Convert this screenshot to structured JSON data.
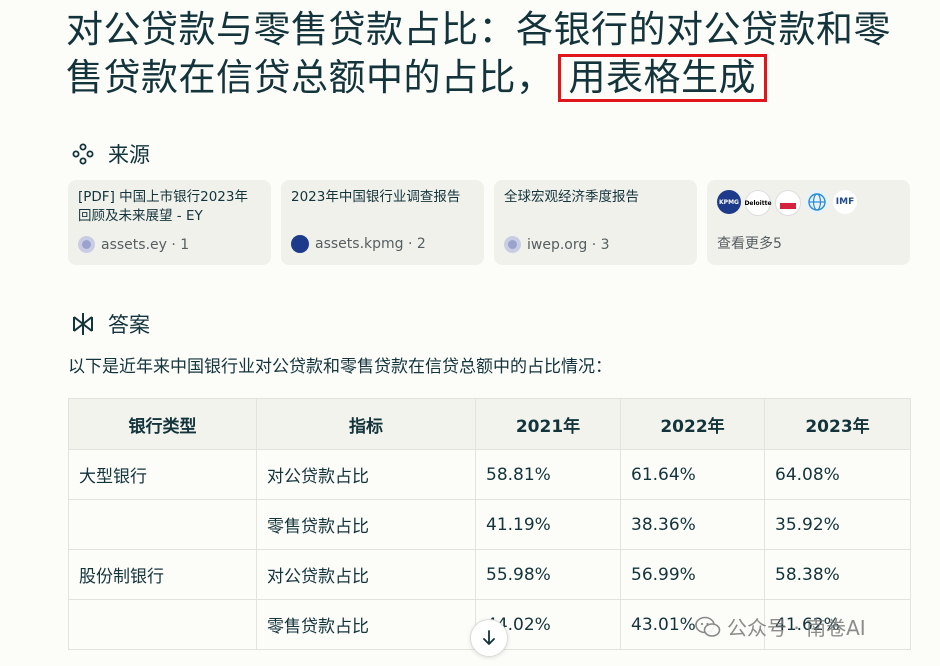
{
  "query": {
    "text": "对公贷款与零售贷款占比：各银行的对公贷款和零售贷款在信贷总额中的占比，",
    "highlight": "用表格生成"
  },
  "sources": {
    "heading": "来源",
    "icon": "sources-icon",
    "cards": [
      {
        "title": "[PDF] 中国上市银行2023年回顾及未来展望 - EY",
        "site": "assets.ey · 1"
      },
      {
        "title": "2023年中国银行业调查报告",
        "site": "assets.kpmg · 2"
      },
      {
        "title": "全球宏观经济季度报告",
        "site": "iwep.org · 3"
      }
    ],
    "more": {
      "label": "查看更多5",
      "logos": [
        "KPMG",
        "Deloitte",
        "",
        "",
        "IMF"
      ]
    }
  },
  "answer": {
    "heading": "答案",
    "icon": "answer-icon",
    "intro": "以下是近年来中国银行业对公贷款和零售贷款在信贷总额中的占比情况：",
    "table": {
      "headers": [
        "银行类型",
        "指标",
        "2021年",
        "2022年",
        "2023年"
      ],
      "rows": [
        [
          "大型银行",
          "对公贷款占比",
          "58.81%",
          "61.64%",
          "64.08%"
        ],
        [
          "",
          "零售贷款占比",
          "41.19%",
          "38.36%",
          "35.92%"
        ],
        [
          "股份制银行",
          "对公贷款占比",
          "55.98%",
          "56.99%",
          "58.38%"
        ],
        [
          "",
          "零售贷款占比",
          "44.02%",
          "43.01%",
          "41.62%"
        ]
      ]
    }
  },
  "watermark": "公众号 · 南卷AI",
  "colors": {
    "highlight_border": "#e0161b",
    "text": "#13343b",
    "card_bg": "#f1f1ec",
    "page_bg": "#fcfcf9"
  }
}
